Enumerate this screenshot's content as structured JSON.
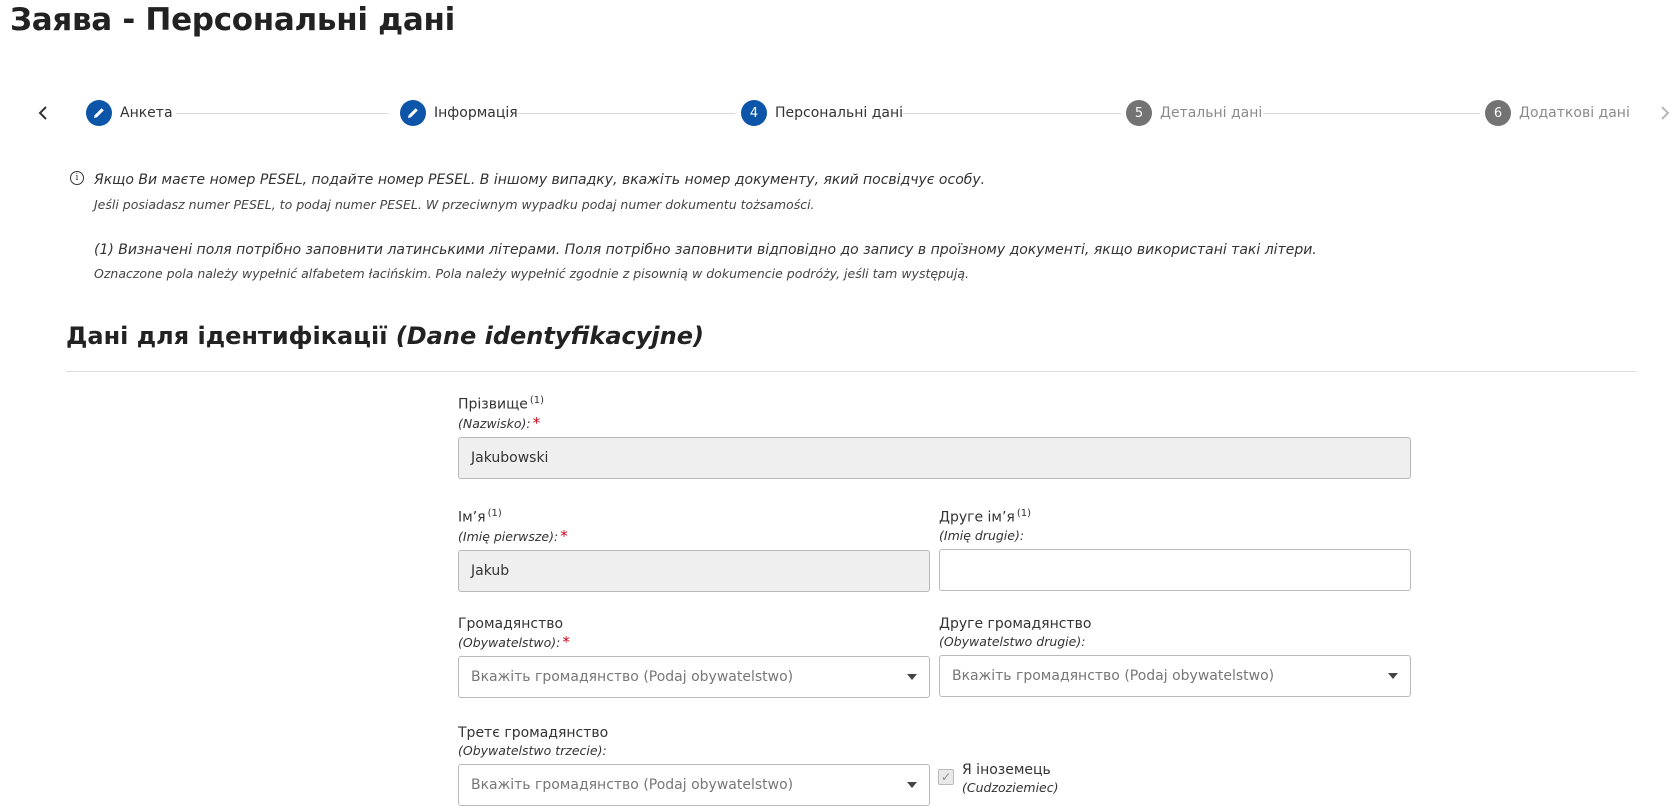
{
  "page_title": "Заява - Персональні дані",
  "stepper": {
    "prev_icon": "chevron-left-icon",
    "next_icon": "chevron-right-icon",
    "steps": [
      {
        "marker": "✎",
        "label": "Анкета",
        "status": "done"
      },
      {
        "marker": "✎",
        "label": "Інформація",
        "status": "done"
      },
      {
        "marker": "4",
        "label": "Персональні дані",
        "status": "current"
      },
      {
        "marker": "5",
        "label": "Детальні дані",
        "status": "pending"
      },
      {
        "marker": "6",
        "label": "Додаткові дані",
        "status": "pending"
      }
    ]
  },
  "notes": {
    "info_icon": "i",
    "pesel_uk": "Якщо Ви маєте номер PESEL, подайте номер PESEL. В іншому випадку, вкажіть номер документу, який посвідчує особу.",
    "pesel_pl": "Jeśli posiadasz numer PESEL, to podaj numer PESEL. W przeciwnym wypadku podaj numer dokumentu tożsamości.",
    "latin_uk": "(1) Визначені поля потрібно заповнити латинськими літерами. Поля потрібно заповнити відповідно до запису в проїзному документі, якщо використані такі літери.",
    "latin_pl": "Oznaczone pola należy wypełnić alfabetem łacińskim. Pola należy wypełnić zgodnie z pisownią w dokumencie podróży, jeśli tam występują."
  },
  "section": {
    "title": "Дані для ідентифікації",
    "title_pl": "(Dane identyfikacyjne)"
  },
  "form": {
    "surname": {
      "label": "Прізвище",
      "sup": "(1)",
      "sublabel": "(Nazwisko):",
      "required": "*",
      "value": "Jakubowski"
    },
    "first_name": {
      "label": "Ім’я",
      "sup": "(1)",
      "sublabel": "(Imię pierwsze):",
      "required": "*",
      "value": "Jakub"
    },
    "second_name": {
      "label": "Друге ім’я",
      "sup": "(1)",
      "sublabel": "(Imię drugie):",
      "value": ""
    },
    "citizenship": {
      "label": "Громадянство",
      "sublabel": "(Obywatelstwo):",
      "required": "*",
      "placeholder": "Вкажіть громадянство (Podaj obywatelstwo)"
    },
    "second_citizenship": {
      "label": "Друге громадянство",
      "sublabel": "(Obywatelstwo drugie):",
      "placeholder": "Вкажіть громадянство (Podaj obywatelstwo)"
    },
    "third_citizenship": {
      "label": "Третє громадянство",
      "sublabel": "(Obywatelstwo trzecie):",
      "placeholder": "Вкажіть громадянство (Podaj obywatelstwo)"
    },
    "foreigner": {
      "label": "Я іноземець",
      "sublabel": "(Cudzoziemiec)",
      "checked": true,
      "check_mark": "✓"
    }
  }
}
